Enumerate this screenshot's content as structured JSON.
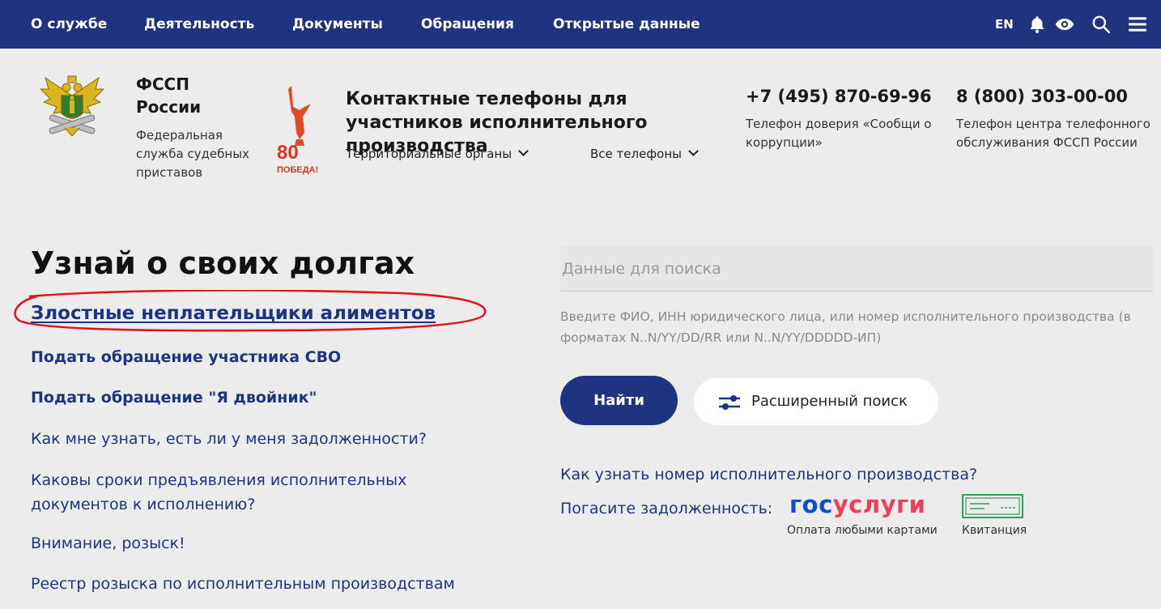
{
  "nav": {
    "items": [
      "О службе",
      "Деятельность",
      "Документы",
      "Обращения",
      "Открытые данные"
    ],
    "lang": "EN",
    "icons": [
      "bell-icon",
      "eye-icon",
      "search-icon",
      "menu-icon"
    ]
  },
  "header": {
    "org_name": "ФССП России",
    "org_desc": "Федеральная служба судебных приставов",
    "victory_badge": "80 ПОБЕДА!",
    "contacts_title": "Контактные телефоны для участников исполнительного производства",
    "dropdowns": [
      "Территориальные органы",
      "Все телефоны"
    ],
    "phones": [
      {
        "number": "+7 (495) 870-69-96",
        "desc": "Телефон доверия «Сообщи о коррупции»"
      },
      {
        "number": "8 (800) 303-00-00",
        "desc": "Телефон центра телефонного обслуживания ФССП России"
      }
    ]
  },
  "main": {
    "title": "Узнай о своих долгах",
    "links": [
      "Злостные неплательщики алиментов",
      "Подать обращение участника СВО",
      "Подать обращение \"Я двойник\"",
      "Как мне узнать, есть ли у меня задолженности?",
      "Каковы сроки предъявления исполнительных документов к исполнению?",
      "Внимание, розыск!",
      "Реестр розыска по исполнительным производствам"
    ]
  },
  "search": {
    "placeholder": "Данные для поиска",
    "hint": "Введите ФИО, ИНН юридического лица, или номер исполнительного производства (в форматах N..N/YY/DD/RR или N..N/YY/DDDDD-ИП)",
    "find_button": "Найти",
    "advanced_button": "Расширенный поиск",
    "how_link": "Как узнать номер исполнительного производства?",
    "pay_label": "Погасите задолженность:",
    "gosuslugi_logo_a": "гос",
    "gosuslugi_logo_b": "услуги",
    "gosuslugi_sub": "Оплата любыми картами",
    "kvitanciya": "Квитанция"
  },
  "colors": {
    "nav_bg": "#1f3480",
    "link": "#1f3480",
    "highlight_circle": "#e0141e",
    "page_bg": "#ececec"
  }
}
